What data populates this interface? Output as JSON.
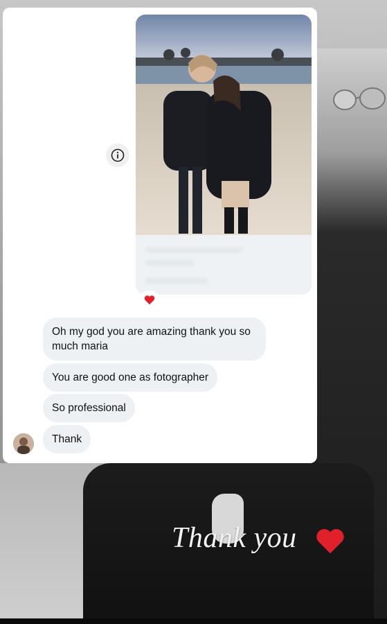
{
  "messages": [
    {
      "text": "Oh my god you are amazing thank you so much maria"
    },
    {
      "text": "You are good one as fotographer"
    },
    {
      "text": "So professional"
    },
    {
      "text": "Thank"
    }
  ],
  "story_overlay": {
    "text": "Thank you"
  },
  "icons": {
    "info": "info-icon",
    "reaction": "heart-emoji-icon",
    "overlay_heart": "heart-emoji-icon"
  },
  "colors": {
    "bubble": "#eef1f3",
    "heart": "#e0202b",
    "card": "#ffffff"
  }
}
